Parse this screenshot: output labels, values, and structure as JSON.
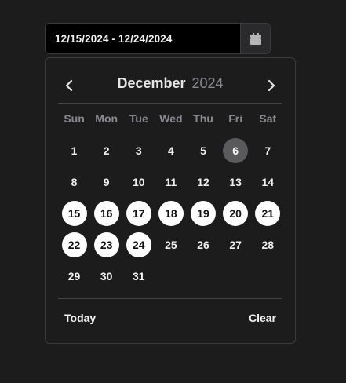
{
  "input": {
    "value": "12/15/2024 - 12/24/2024"
  },
  "header": {
    "month": "December",
    "year": "2024"
  },
  "weekdays": [
    "Sun",
    "Mon",
    "Tue",
    "Wed",
    "Thu",
    "Fri",
    "Sat"
  ],
  "calendar": {
    "first_day_offset": 0,
    "days": [
      "1",
      "2",
      "3",
      "4",
      "5",
      "6",
      "7",
      "8",
      "9",
      "10",
      "11",
      "12",
      "13",
      "14",
      "15",
      "16",
      "17",
      "18",
      "19",
      "20",
      "21",
      "22",
      "23",
      "24",
      "25",
      "26",
      "27",
      "28",
      "29",
      "30",
      "31"
    ],
    "today": "6",
    "selected": [
      "15",
      "16",
      "17",
      "18",
      "19",
      "20",
      "21",
      "22",
      "23",
      "24"
    ]
  },
  "footer": {
    "today_label": "Today",
    "clear_label": "Clear"
  },
  "colors": {
    "background": "#1c1c1d",
    "selected_bg": "#ffffff",
    "today_bg": "#5a5a5d",
    "muted": "#8a8a8e"
  }
}
